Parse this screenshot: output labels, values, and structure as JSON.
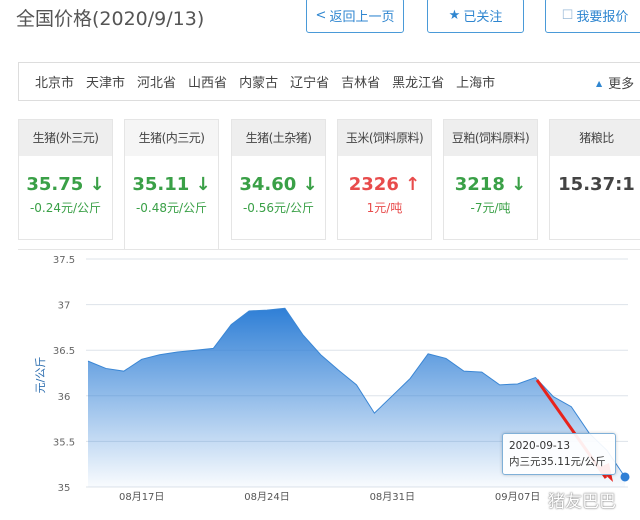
{
  "header": {
    "title": "全国价格(2020/9/13)",
    "back_label": "返回上一页",
    "follow_label": "已关注",
    "quote_label": "我要报价"
  },
  "regions": {
    "items": [
      "北京市",
      "天津市",
      "河北省",
      "山西省",
      "内蒙古",
      "辽宁省",
      "吉林省",
      "黑龙江省",
      "上海市"
    ],
    "more_label": "更多"
  },
  "cards": [
    {
      "title": "生猪(外三元)",
      "value": "35.75",
      "arrow": "↓",
      "change": "-0.24元/公斤",
      "trend": "down"
    },
    {
      "title": "生猪(内三元)",
      "value": "35.11",
      "arrow": "↓",
      "change": "-0.48元/公斤",
      "trend": "down"
    },
    {
      "title": "生猪(土杂猪)",
      "value": "34.60",
      "arrow": "↓",
      "change": "-0.56元/公斤",
      "trend": "down"
    },
    {
      "title": "玉米(饲料原料)",
      "value": "2326",
      "arrow": "↑",
      "change": "1元/吨",
      "trend": "up"
    },
    {
      "title": "豆粕(饲料原料)",
      "value": "3218",
      "arrow": "↓",
      "change": "-7元/吨",
      "trend": "down"
    },
    {
      "title": "猪粮比",
      "value": "15.37:1",
      "arrow": "",
      "change": "",
      "trend": "none"
    }
  ],
  "colors": {
    "accent": "#2f86d0",
    "down": "#3aa047",
    "up": "#e84c4c",
    "area": "#2f7fd6"
  },
  "tooltip": {
    "date": "2020-09-13",
    "text": "内三元35.11元/公斤"
  },
  "watermark": "猪友巴巴",
  "chart_data": {
    "type": "area",
    "ylabel": "元/公斤",
    "ylim": [
      35,
      37.5
    ],
    "yticks": [
      "35",
      "35.5",
      "36",
      "36.5",
      "37",
      "37.5"
    ],
    "xticks": [
      "08月17日",
      "08月24日",
      "08月31日",
      "09月07日"
    ],
    "xtick_dates": [
      "08/17",
      "08/24",
      "08/31",
      "09/07"
    ],
    "x": [
      "08/14",
      "08/15",
      "08/16",
      "08/17",
      "08/18",
      "08/19",
      "08/20",
      "08/21",
      "08/22",
      "08/23",
      "08/24",
      "08/25",
      "08/26",
      "08/27",
      "08/28",
      "08/29",
      "08/30",
      "08/31",
      "09/01",
      "09/02",
      "09/03",
      "09/04",
      "09/05",
      "09/06",
      "09/07",
      "09/08",
      "09/09",
      "09/10",
      "09/11",
      "09/12",
      "09/13"
    ],
    "series": [
      {
        "name": "内三元",
        "values": [
          36.38,
          36.3,
          36.27,
          36.4,
          36.45,
          36.48,
          36.5,
          36.52,
          36.78,
          36.93,
          36.94,
          36.96,
          36.67,
          36.45,
          36.28,
          36.12,
          35.81,
          36.0,
          36.19,
          36.46,
          36.41,
          36.27,
          36.26,
          36.12,
          36.13,
          36.2,
          35.99,
          35.88,
          35.59,
          35.4,
          35.11
        ]
      }
    ],
    "grid": true
  }
}
